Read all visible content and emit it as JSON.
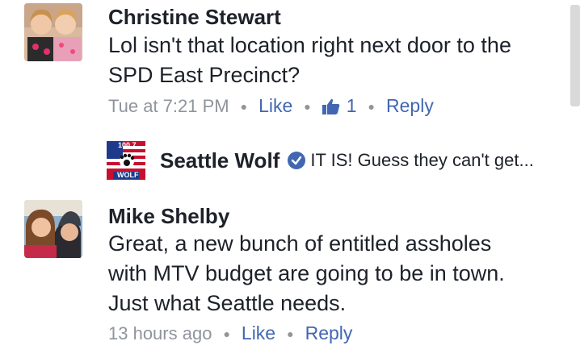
{
  "comments": [
    {
      "author": "Christine Stewart",
      "text_line1": "Lol isn't that location right next door to the",
      "text_line2": "SPD East Precinct?",
      "timestamp": "Tue at 7:21 PM",
      "like_label": "Like",
      "like_count": "1",
      "reply_label": "Reply"
    },
    {
      "author": "Mike Shelby",
      "text_line1": "Great, a new bunch of entitled assholes",
      "text_line2": "with MTV budget are going to be in town.",
      "text_line3": "Just what Seattle needs.",
      "timestamp": "13 hours ago",
      "like_label": "Like",
      "reply_label": "Reply"
    }
  ],
  "reply_preview": {
    "author": "Seattle Wolf",
    "text": "IT IS! Guess they can't get...",
    "logo_top": "100.7",
    "logo_bottom": "WOLF"
  },
  "colors": {
    "link": "#4267b2",
    "meta": "#90949c",
    "text": "#1d2129"
  }
}
